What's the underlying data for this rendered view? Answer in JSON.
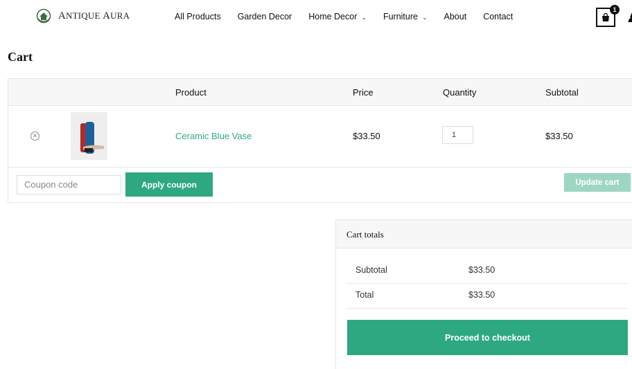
{
  "brand": {
    "name_first": "A",
    "name_rest": "NTIQUE",
    "name_second_first": "A",
    "name_second_rest": "URA"
  },
  "nav": {
    "items": [
      {
        "label": "All Products",
        "has_dropdown": false
      },
      {
        "label": "Garden Decor",
        "has_dropdown": false
      },
      {
        "label": "Home Decor",
        "has_dropdown": true
      },
      {
        "label": "Furniture",
        "has_dropdown": true
      },
      {
        "label": "About",
        "has_dropdown": false
      },
      {
        "label": "Contact",
        "has_dropdown": false
      }
    ],
    "cart_count": "1"
  },
  "page": {
    "title": "Cart"
  },
  "cart_table": {
    "headers": {
      "product": "Product",
      "price": "Price",
      "quantity": "Quantity",
      "subtotal": "Subtotal"
    },
    "items": [
      {
        "name": "Ceramic Blue Vase",
        "price": "$33.50",
        "quantity": "1",
        "subtotal": "$33.50"
      }
    ],
    "coupon_placeholder": "Coupon code",
    "apply_coupon_label": "Apply coupon",
    "update_cart_label": "Update cart"
  },
  "totals": {
    "title": "Cart totals",
    "subtotal_label": "Subtotal",
    "subtotal_value": "$33.50",
    "total_label": "Total",
    "total_value": "$33.50",
    "checkout_label": "Proceed to checkout"
  },
  "colors": {
    "accent": "#2ea882",
    "accent_disabled": "#9ed6c3",
    "link": "#2eaa80"
  },
  "icons": {
    "remove": "close-circle-icon",
    "cart": "shopping-bag-icon",
    "user": "user-icon",
    "chevron": "chevron-down-icon"
  }
}
